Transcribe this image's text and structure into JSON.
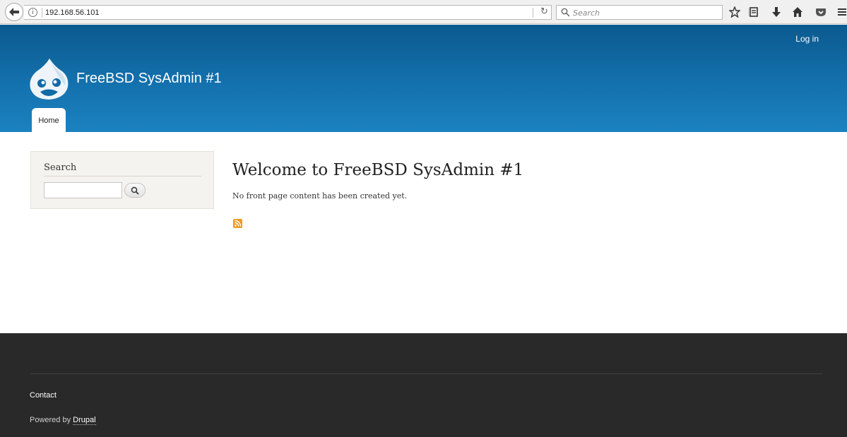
{
  "browser": {
    "url": "192.168.56.101",
    "search_placeholder": "Search",
    "icons": [
      "back-arrow-icon",
      "info-icon",
      "reload-icon",
      "search-icon",
      "star-icon",
      "reading-list-icon",
      "download-icon",
      "home-icon",
      "pocket-icon",
      "menu-icon"
    ]
  },
  "header": {
    "login_label": "Log in",
    "site_name": "FreeBSD SysAdmin #1",
    "nav": [
      {
        "label": "Home",
        "active": true
      }
    ]
  },
  "sidebar": {
    "search_block_title": "Search",
    "search_value": ""
  },
  "main": {
    "title": "Welcome to FreeBSD SysAdmin #1",
    "text": "No front page content has been created yet."
  },
  "footer": {
    "contact_label": "Contact",
    "powered_prefix": "Powered by",
    "drupal_label": "Drupal"
  },
  "colors": {
    "header_top": "#0b5a8f",
    "header_bottom": "#1b82c0",
    "footer_bg": "#292929",
    "rss": "#f19a1e"
  }
}
